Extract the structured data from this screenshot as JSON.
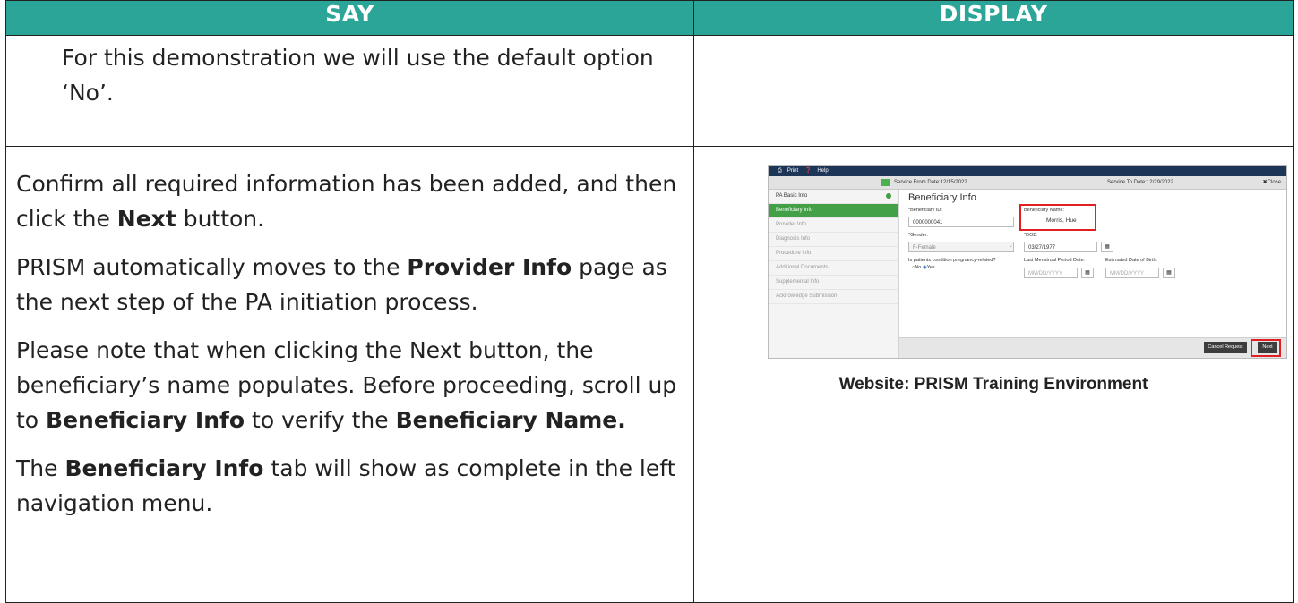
{
  "header": {
    "say": "SAY",
    "display": "DISPLAY"
  },
  "row1": {
    "say": "For this demonstration we will use the default option ‘No’."
  },
  "row2": {
    "p1": {
      "a": "Confirm all required information has been added, and then click the ",
      "b": "Next",
      "c": " button."
    },
    "p2": {
      "a": "PRISM automatically moves to the ",
      "b": "Provider Info",
      "c": " page as the next step of the PA initiation process."
    },
    "p3": {
      "a": "Please note that when clicking the Next button, the beneficiary’s name populates. Before proceeding, scroll up to ",
      "b": "Beneficiary Info",
      "c": " to verify the ",
      "d": "Beneficiary Name."
    },
    "p4": {
      "a": "The ",
      "b": "Beneficiary Info",
      "c": " tab will show as complete in the left navigation menu."
    },
    "caption": "Website: PRISM Training Environment"
  },
  "screenshot": {
    "toolbar": {
      "print": "Print",
      "help": "Help"
    },
    "service_from": "Service From Date:12/15/2022",
    "service_to": "Service To Date:12/29/2022",
    "close": "✖Close",
    "nav": [
      {
        "label": "PA Basic Info"
      },
      {
        "label": "Beneficiary Info"
      },
      {
        "label": "Provider Info"
      },
      {
        "label": "Diagnosis Info"
      },
      {
        "label": "Procedure Info"
      },
      {
        "label": "Additional Documents"
      },
      {
        "label": "Supplemental Info"
      },
      {
        "label": "Acknowledge Submission"
      }
    ],
    "title": "Beneficiary Info",
    "beneficiary_id_label": "*Beneficiary ID:",
    "beneficiary_id": "0000000041",
    "beneficiary_name_label": "Beneficiary Name:",
    "beneficiary_name": "Morris, Hue",
    "gender_label": "*Gender:",
    "gender": "F-Female",
    "dob_label": "*DOB:",
    "dob": "03/27/1977",
    "pregnancy_label": "Is patients condition pregnancy-related?",
    "radio_no": "No",
    "radio_yes": "Yes",
    "lmp_label": "Last Menstrual Period Date:",
    "lmp_placeholder": "MM/DD/YYYY",
    "edb_label": "Estimated Date of Birth:",
    "edb_placeholder": "MM/DD/YYYY",
    "cancel_button": "Cancel Request",
    "next_button": "Next",
    "highlight_color": "#e02020",
    "active_color": "#43a047"
  }
}
